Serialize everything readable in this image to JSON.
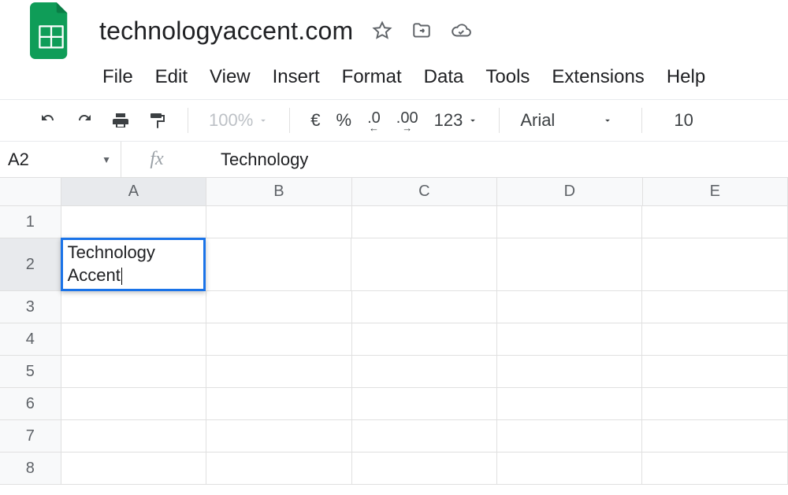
{
  "doc": {
    "title": "technologyaccent.com"
  },
  "menus": {
    "file": "File",
    "edit": "Edit",
    "view": "View",
    "insert": "Insert",
    "format": "Format",
    "data": "Data",
    "tools": "Tools",
    "extensions": "Extensions",
    "help": "Help"
  },
  "toolbar": {
    "zoom": "100%",
    "currency": "€",
    "percent": "%",
    "dec_decrease": ".0",
    "dec_increase": ".00",
    "more_formats": "123",
    "font": "Arial",
    "font_size": "10"
  },
  "formula": {
    "cellref": "A2",
    "content": "Technology"
  },
  "columns": [
    "A",
    "B",
    "C",
    "D",
    "E"
  ],
  "active_col": "A",
  "rows": [
    "1",
    "2",
    "3",
    "4",
    "5",
    "6",
    "7",
    "8"
  ],
  "active_row": "2",
  "editing_cell": {
    "line1": "Technology",
    "line2": "Accent"
  }
}
